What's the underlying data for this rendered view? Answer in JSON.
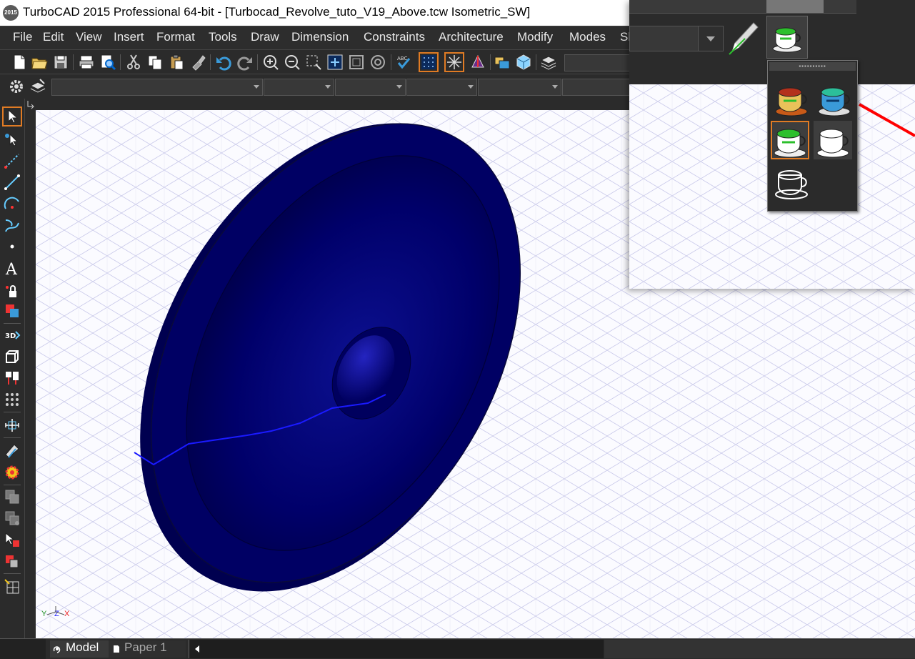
{
  "window": {
    "logo_text": "2015",
    "title": "TurboCAD 2015 Professional 64-bit - [Turbocad_Revolve_tuto_V19_Above.tcw Isometric_SW]"
  },
  "menu": {
    "items": [
      "File",
      "Edit",
      "View",
      "Insert",
      "Format",
      "Tools",
      "Draw",
      "Dimension",
      "Constraints",
      "Architecture",
      "Modify",
      "Modes",
      "Sl"
    ]
  },
  "tabs": {
    "model": "Model",
    "paper": "Paper 1"
  },
  "colors": {
    "object_fill": "#000060",
    "object_highlight": "#1a1aa8",
    "accent": "#e07b24",
    "grid_line": "#c9c9ea",
    "axis_red": "#ff0000",
    "profile_line": "#1a1aff"
  },
  "popup": {
    "title_dots": "▪▪▪▪▪▪▪▪▪▪"
  }
}
